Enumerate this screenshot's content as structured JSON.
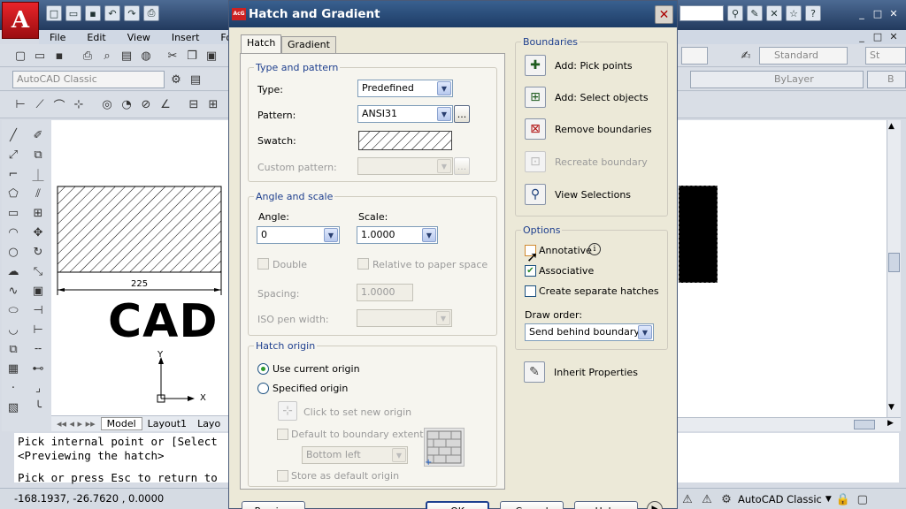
{
  "app": {
    "logo_letter": "A",
    "menu": [
      "File",
      "Edit",
      "View",
      "Insert",
      "Forma"
    ],
    "workspace_combo": "AutoCAD Classic",
    "style_combo": "Standard",
    "layer_combo": "ByLayer",
    "layer_combo2": "B",
    "style_combo2": "St",
    "tabs": [
      "Model",
      "Layout1",
      "Layo"
    ],
    "drawing_text": "CAD",
    "dim_value": "225",
    "axis_y": "Y",
    "axis_x": "X",
    "cmd_lines": [
      "Pick internal point or [Select",
      "<Previewing the hatch>",
      "",
      "Pick or press Esc to return to"
    ],
    "coords": "-168.1937, -26.7620 , 0.0000",
    "status_workspace": "AutoCAD Classic"
  },
  "dialog": {
    "title": "Hatch and Gradient",
    "title_icon": "AcG",
    "tabs": [
      "Hatch",
      "Gradient"
    ],
    "type_and_pattern": {
      "label": "Type and pattern",
      "type_label": "Type:",
      "type_value": "Predefined",
      "pattern_label": "Pattern:",
      "pattern_value": "ANSI31",
      "ellipsis": "...",
      "swatch_label": "Swatch:",
      "custom_label": "Custom pattern:"
    },
    "angle_and_scale": {
      "label": "Angle and scale",
      "angle_label": "Angle:",
      "angle_value": "0",
      "scale_label": "Scale:",
      "scale_value": "1.0000",
      "double_label": "Double",
      "relative_label": "Relative to paper space",
      "spacing_label": "Spacing:",
      "spacing_value": "1.0000",
      "iso_label": "ISO pen width:"
    },
    "hatch_origin": {
      "label": "Hatch origin",
      "use_current": "Use current origin",
      "specified": "Specified origin",
      "click_set": "Click to set new origin",
      "default_ext": "Default to boundary extents",
      "position": "Bottom left",
      "store_default": "Store as default origin"
    },
    "boundaries": {
      "label": "Boundaries",
      "pick_points": "Add: Pick points",
      "select_objects": "Add: Select objects",
      "remove": "Remove boundaries",
      "recreate": "Recreate boundary",
      "view": "View Selections"
    },
    "options": {
      "label": "Options",
      "annotative": "Annotative",
      "associative": "Associative",
      "separate": "Create separate hatches",
      "draw_order_label": "Draw order:",
      "draw_order_value": "Send behind boundary"
    },
    "inherit": "Inherit Properties",
    "buttons": {
      "preview": "Preview",
      "ok": "OK",
      "cancel": "Cancel",
      "help": "Help"
    }
  }
}
